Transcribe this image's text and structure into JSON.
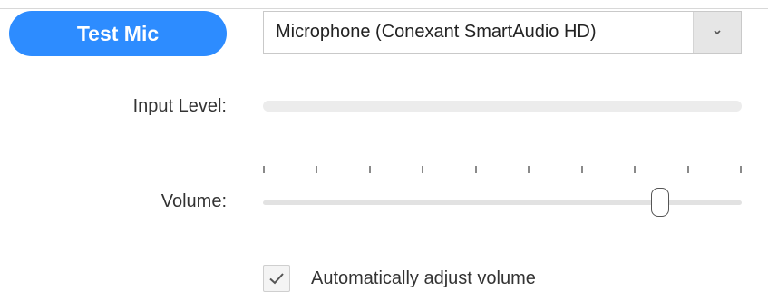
{
  "test_mic_button": {
    "label": "Test Mic"
  },
  "microphone_select": {
    "selected": "Microphone (Conexant SmartAudio HD)",
    "arrow_icon": "chevron-down-icon"
  },
  "input_level": {
    "label": "Input Level:",
    "level": 0
  },
  "volume": {
    "label": "Volume:",
    "value": 0.83,
    "tick_count": 10
  },
  "auto_adjust": {
    "label": "Automatically adjust volume",
    "checked": true,
    "icon": "checkmark-icon"
  },
  "colors": {
    "accent": "#2d8cff",
    "track": "#e2e2e2",
    "text": "#333333"
  }
}
